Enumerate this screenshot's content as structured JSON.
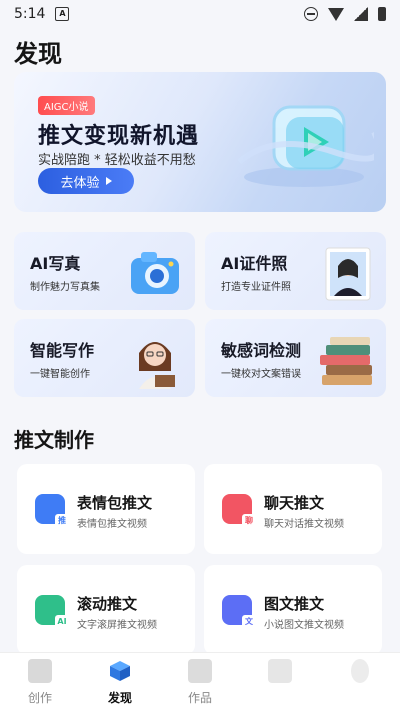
{
  "status_bar": {
    "time": "5:14",
    "notification_letter": "A"
  },
  "page_title": "发现",
  "banner": {
    "tag": "AIGC小说",
    "headline": "推文变现新机遇",
    "subline": "实战陪跑 * 轻松收益不用愁",
    "cta_label": "去体验"
  },
  "feature_cards": [
    {
      "title": "AI写真",
      "subtitle": "制作魅力写真集",
      "icon": "camera-icon"
    },
    {
      "title": "AI证件照",
      "subtitle": "打造专业证件照",
      "icon": "id-photo-icon"
    },
    {
      "title": "智能写作",
      "subtitle": "一键智能创作",
      "icon": "writer-avatar-icon"
    },
    {
      "title": "敏感词检测",
      "subtitle": "一键校对文案错误",
      "icon": "books-icon"
    }
  ],
  "section_title": "推文制作",
  "tools": [
    {
      "title": "表情包推文",
      "subtitle": "表情包推文视频",
      "icon": "meme-icon",
      "color": "#3f7cf5",
      "badge": "推"
    },
    {
      "title": "聊天推文",
      "subtitle": "聊天对话推文视频",
      "icon": "chat-icon",
      "color": "#f25563",
      "badge": "聊"
    },
    {
      "title": "滚动推文",
      "subtitle": "文字滚屏推文视频",
      "icon": "scroll-text-icon",
      "color": "#2fbf8a",
      "badge": "AI"
    },
    {
      "title": "图文推文",
      "subtitle": "小说图文推文视频",
      "icon": "image-text-icon",
      "color": "#5c6ef5",
      "badge": "文"
    }
  ],
  "tabbar": {
    "items": [
      {
        "label": "创作",
        "active": false,
        "icon": "create-icon"
      },
      {
        "label": "发现",
        "active": true,
        "icon": "discover-cube-icon"
      },
      {
        "label": "作品",
        "active": false,
        "icon": "works-icon"
      },
      {
        "label": "",
        "active": false,
        "icon": "tab4-icon"
      },
      {
        "label": "",
        "active": false,
        "icon": "tab5-icon"
      }
    ],
    "active_color": "#111111",
    "inactive_color": "#888888"
  }
}
